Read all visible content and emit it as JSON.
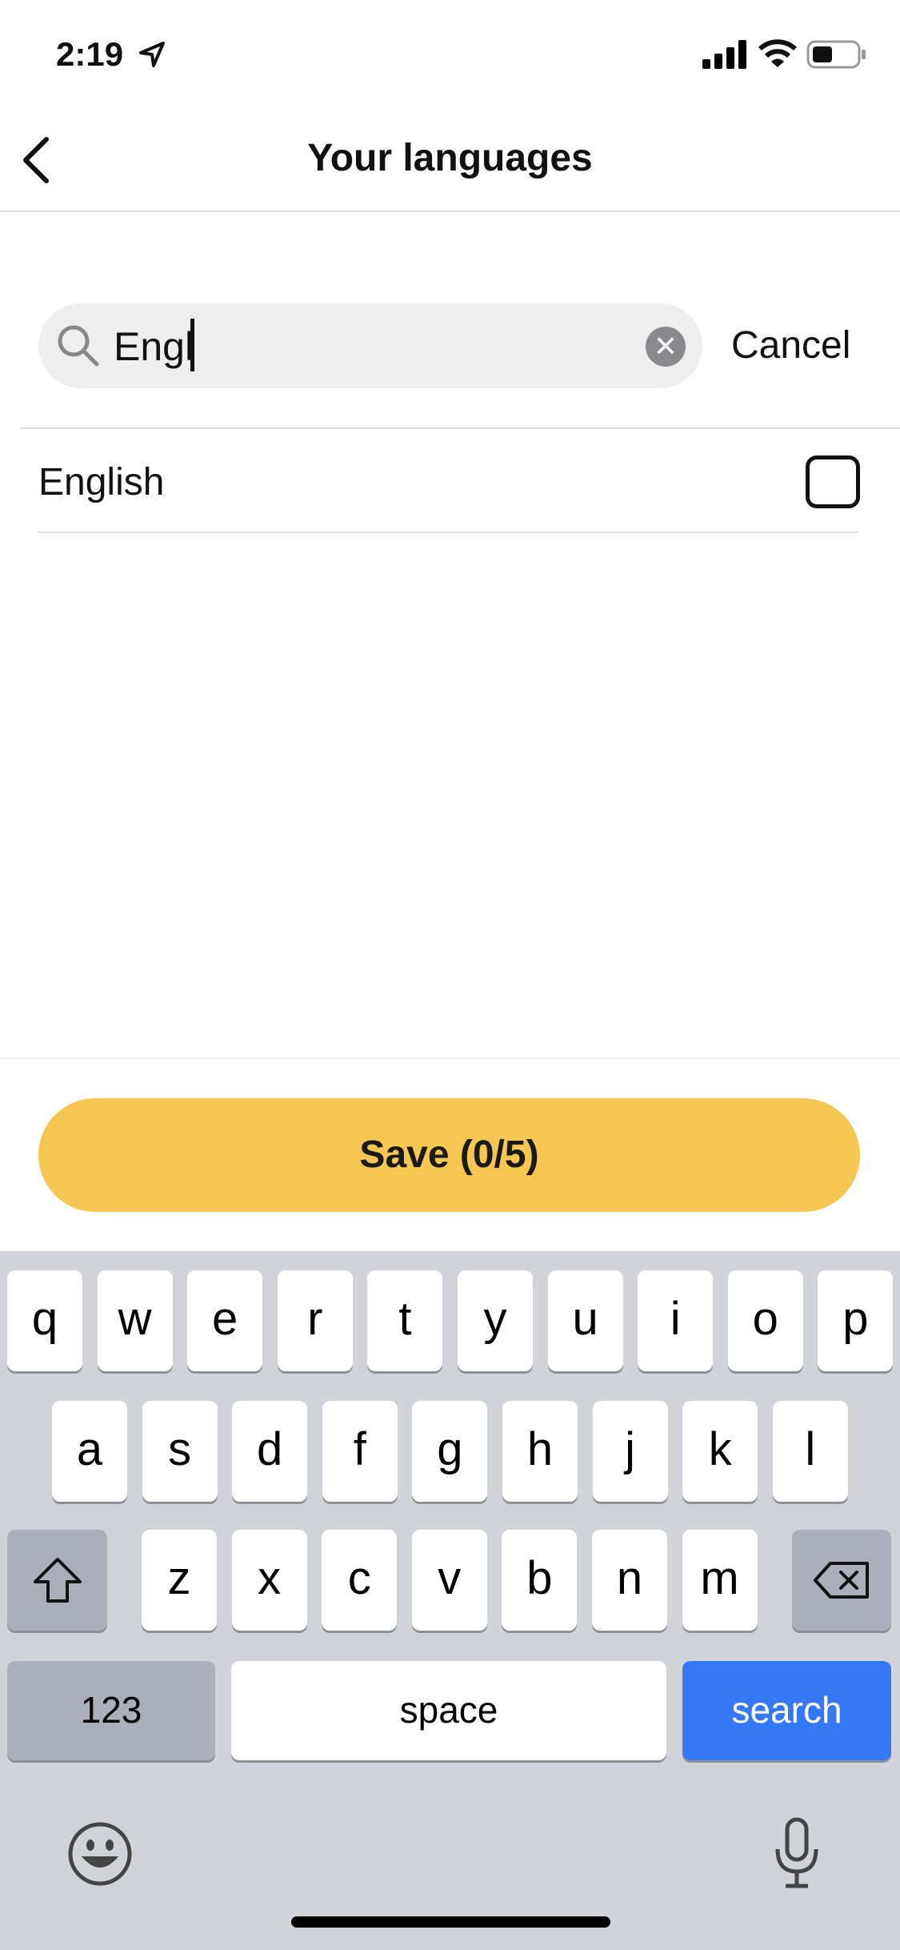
{
  "status": {
    "time": "2:19"
  },
  "nav": {
    "title": "Your languages"
  },
  "search": {
    "value": "Engl",
    "cancel": "Cancel"
  },
  "results": [
    {
      "label": "English",
      "checked": false
    }
  ],
  "save": {
    "label": "Save (0/5)"
  },
  "keyboard": {
    "row1": [
      "q",
      "w",
      "e",
      "r",
      "t",
      "y",
      "u",
      "i",
      "o",
      "p"
    ],
    "row2": [
      "a",
      "s",
      "d",
      "f",
      "g",
      "h",
      "j",
      "k",
      "l"
    ],
    "row3": [
      "z",
      "x",
      "c",
      "v",
      "b",
      "n",
      "m"
    ],
    "numbers": "123",
    "space": "space",
    "search": "search"
  },
  "colors": {
    "accent": "#F5C651",
    "search_key": "#3478F6"
  }
}
